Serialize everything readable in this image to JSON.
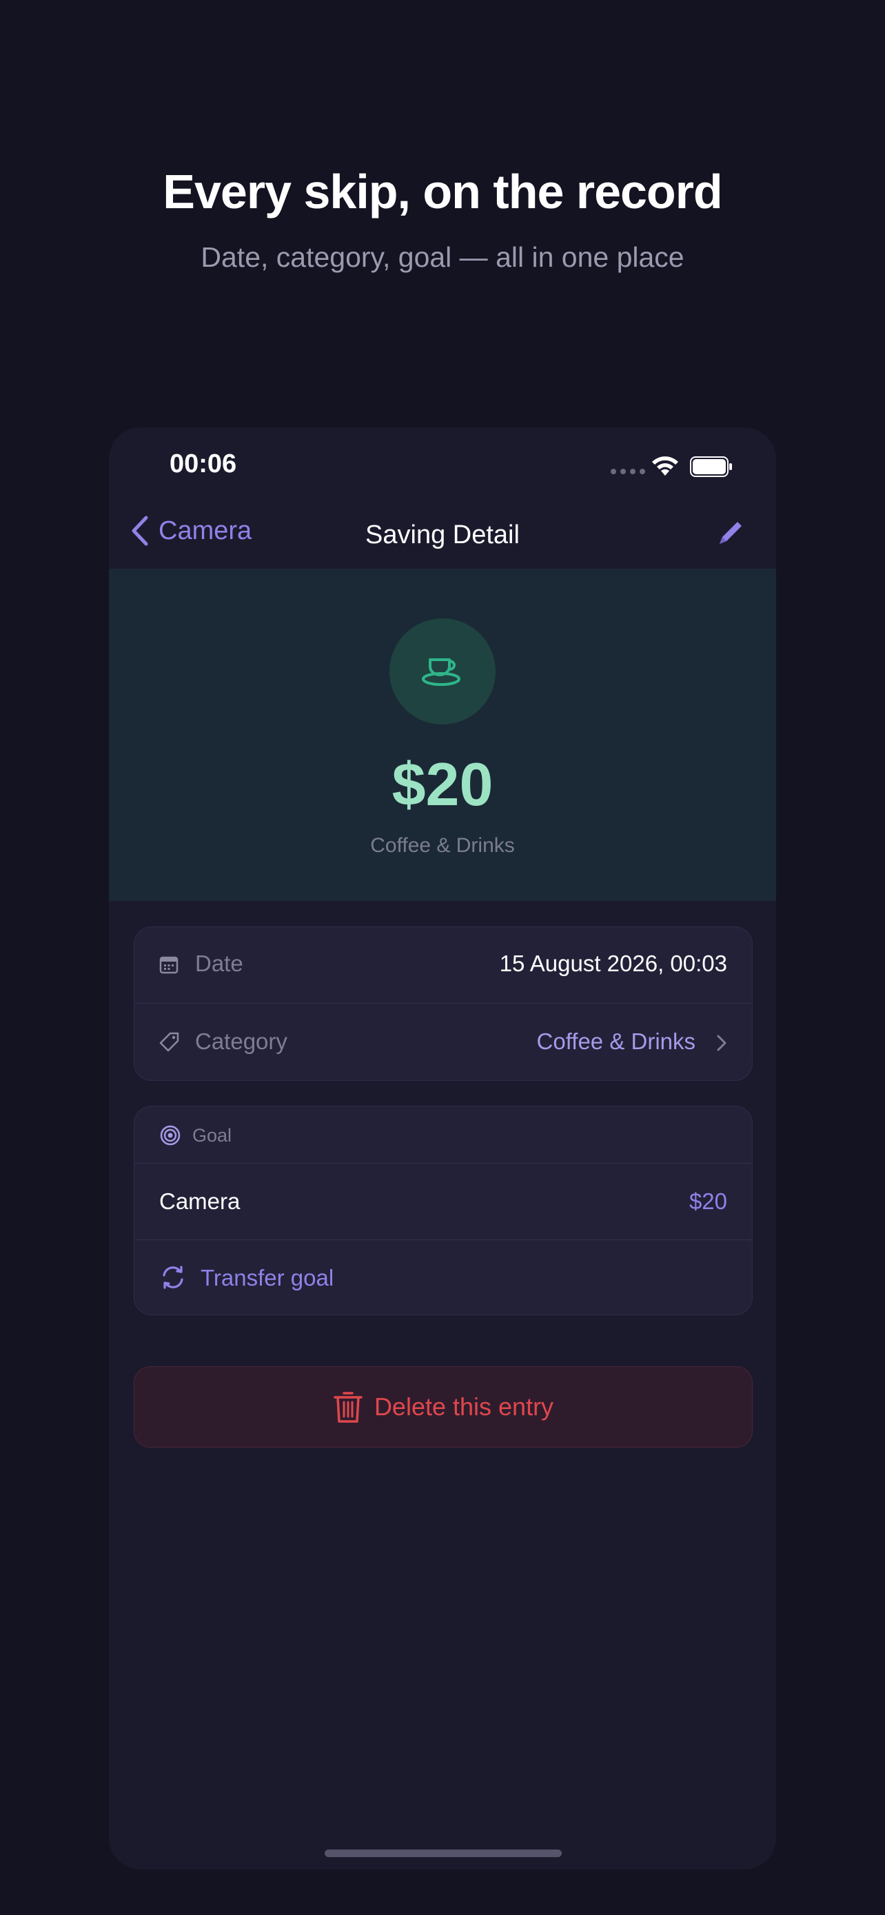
{
  "promo": {
    "headline": "Every skip, on the record",
    "subheadline": "Date, category, goal — all in one place"
  },
  "status_bar": {
    "time": "00:06"
  },
  "nav": {
    "back_label": "Camera",
    "title": "Saving Detail"
  },
  "hero": {
    "amount": "$20",
    "category": "Coffee & Drinks",
    "icon": "coffee-cup-icon"
  },
  "details": {
    "date_label": "Date",
    "date_value": "15 August 2026, 00:03",
    "category_label": "Category",
    "category_value": "Coffee & Drinks"
  },
  "goal": {
    "section_label": "Goal",
    "name": "Camera",
    "amount": "$20",
    "transfer_label": "Transfer goal"
  },
  "actions": {
    "delete_label": "Delete this entry"
  },
  "colors": {
    "background": "#141322",
    "accent": "#8f82e8",
    "amount_green": "#9ce3c4",
    "danger": "#e0474d"
  }
}
